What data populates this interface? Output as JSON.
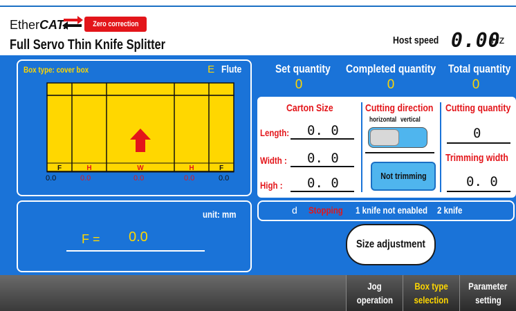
{
  "header": {
    "logo_prefix": "Ether",
    "logo_bold": "CAT.",
    "zero_correction": "Zero correction",
    "title": "Full Servo Thin Knife Splitter",
    "host_speed_label": "Host speed",
    "host_speed_value": "0.00",
    "host_speed_unit": "Hz"
  },
  "box_panel": {
    "box_type": "Box type: cover box",
    "flute_letter": "E",
    "flute_label": "Flute",
    "segments": [
      {
        "label": "F",
        "value": "0.0"
      },
      {
        "label": "H",
        "value": "0.0"
      },
      {
        "label": "W",
        "value": "0.0"
      },
      {
        "label": "H",
        "value": "0.0"
      },
      {
        "label": "F",
        "value": "0.0"
      }
    ]
  },
  "f_panel": {
    "unit": "unit: mm",
    "f_label": "F  =",
    "f_value": "0.0"
  },
  "quantities": [
    {
      "label": "Set quantity",
      "value": "0"
    },
    {
      "label": "Completed quantity",
      "value": "0"
    },
    {
      "label": "Total quantity",
      "value": "0"
    }
  ],
  "carton": {
    "header": "Carton Size",
    "length_label": "Length:",
    "length_value": "0. 0",
    "width_label": "Width :",
    "width_value": "0. 0",
    "high_label": "High :",
    "high_value": "0. 0"
  },
  "cutting_direction": {
    "header": "Cutting direction",
    "option_h": "horizontal",
    "option_v": "vertical",
    "not_trimming": "Not trimming"
  },
  "cutting_quantity": {
    "header": "Cutting quantity",
    "value": "0",
    "trim_header": "Trimming width",
    "trim_value": "0. 0"
  },
  "status": {
    "d": "d",
    "state": "Stopping",
    "knife1": "1 knife not enabled",
    "knife2": "2 knife"
  },
  "size_adjustment": "Size adjustment",
  "nav": [
    {
      "line1": "Jog",
      "line2": "operation",
      "color": "#ffffff"
    },
    {
      "line1": "Box type",
      "line2": "selection",
      "color": "#ffd700"
    },
    {
      "line1": "Parameter",
      "line2": "setting",
      "color": "#ffffff"
    }
  ],
  "colors": {
    "accent_blue": "#1a73d8",
    "yellow": "#ffd700",
    "red": "#e3151a"
  }
}
